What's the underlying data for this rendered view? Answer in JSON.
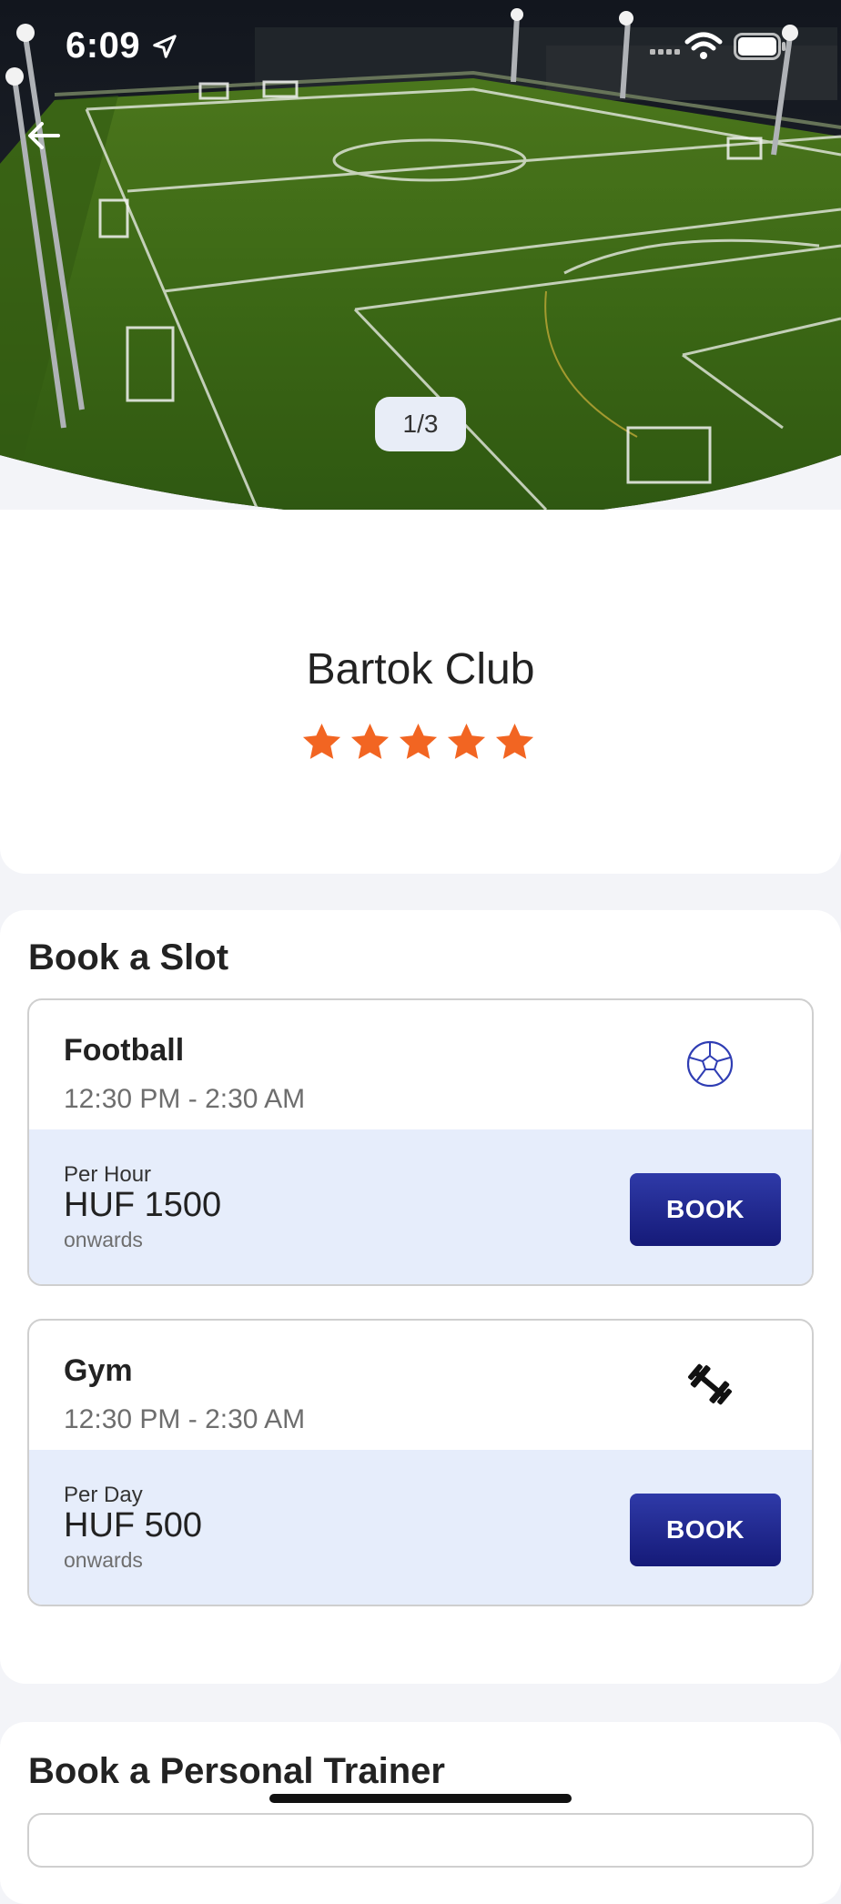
{
  "status_bar": {
    "time": "6:09",
    "icons": [
      "location-arrow-icon",
      "signal-icon",
      "wifi-icon",
      "battery-icon"
    ]
  },
  "hero": {
    "image": "football-pitch-photo",
    "carousel_counter": "1/3",
    "back_icon": "arrow-left-icon"
  },
  "club": {
    "name": "Bartok Club",
    "rating": 5,
    "rating_max": 5,
    "star_color": "#f26522"
  },
  "book_slot": {
    "title": "Book a Slot",
    "slots": [
      {
        "name": "Football",
        "time": "12:30 PM - 2:30 AM",
        "icon": "soccer-ball-icon",
        "price_unit": "Per Hour",
        "price": "HUF 1500",
        "note": "onwards",
        "button": "BOOK"
      },
      {
        "name": "Gym",
        "time": "12:30 PM - 2:30 AM",
        "icon": "dumbbell-icon",
        "price_unit": "Per Day",
        "price": "HUF 500",
        "note": "onwards",
        "button": "BOOK"
      }
    ]
  },
  "personal_trainer": {
    "title": "Book a Personal Trainer"
  },
  "colors": {
    "primary_button": "#1a2090",
    "price_panel": "#e6edfb",
    "accent_star": "#f26522"
  }
}
